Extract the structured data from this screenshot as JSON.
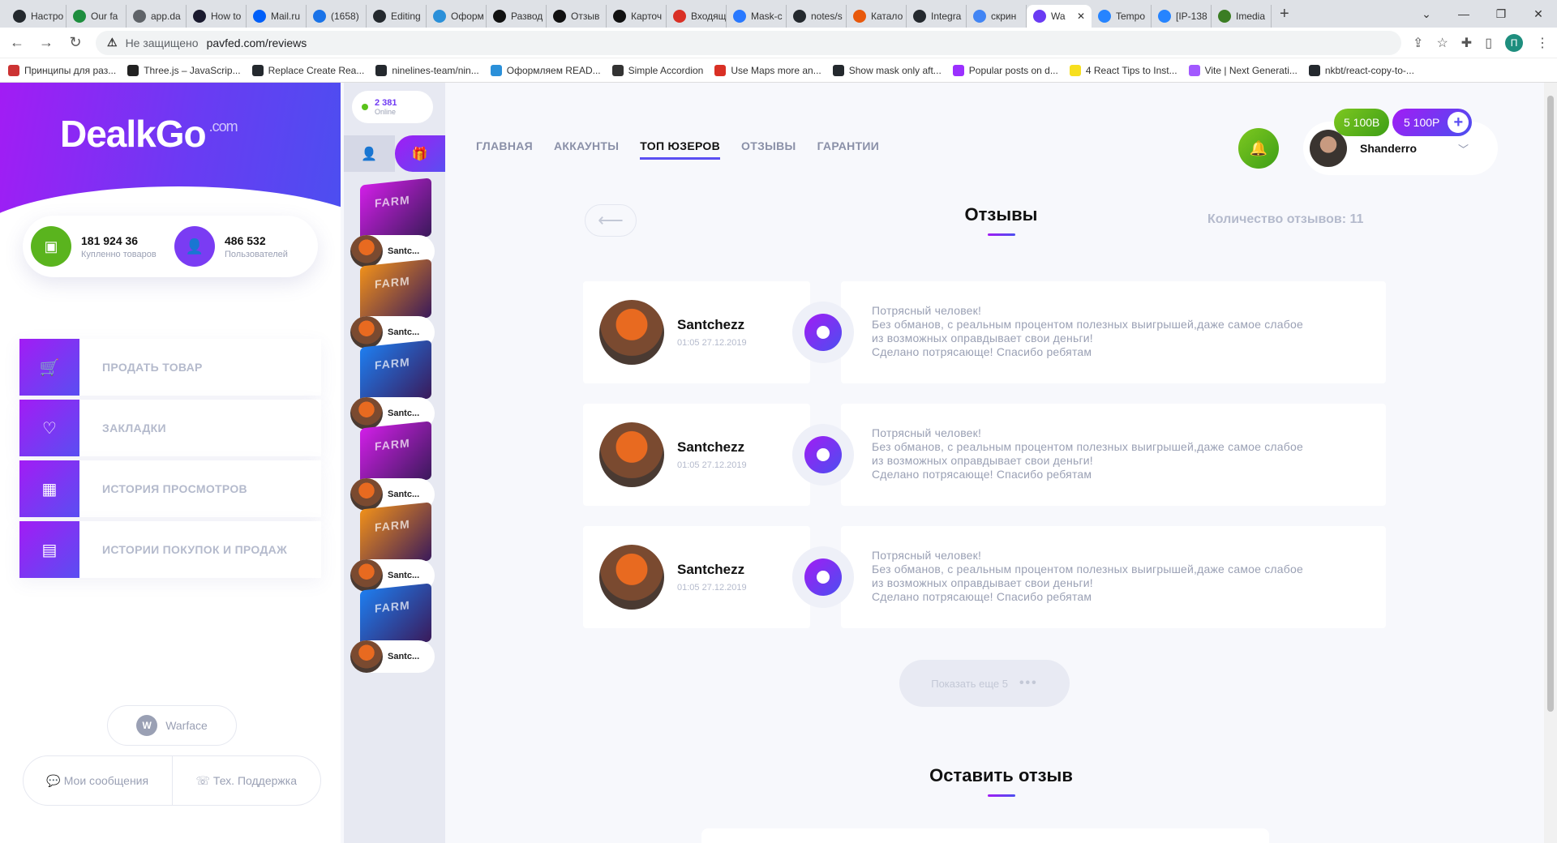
{
  "browser": {
    "tabs": [
      {
        "label": "Настро",
        "color": "#24292e"
      },
      {
        "label": "Our fa",
        "color": "#1e8e3e"
      },
      {
        "label": "app.da",
        "color": "#5f6368"
      },
      {
        "label": "How to",
        "color": "#1a1a2e"
      },
      {
        "label": "Mail.ru",
        "color": "#005ff9"
      },
      {
        "label": "(1658)",
        "color": "#1a73e8"
      },
      {
        "label": "Editing",
        "color": "#24292e"
      },
      {
        "label": "Оформ",
        "color": "#2b90d9"
      },
      {
        "label": "Развод",
        "color": "#111111"
      },
      {
        "label": "Отзыв",
        "color": "#111111"
      },
      {
        "label": "Карточ",
        "color": "#111111"
      },
      {
        "label": "Входящ",
        "color": "#d93025"
      },
      {
        "label": "Mask-c",
        "color": "#2979ff"
      },
      {
        "label": "notes/s",
        "color": "#24292e"
      },
      {
        "label": "Катало",
        "color": "#e8590c"
      },
      {
        "label": "Integra",
        "color": "#24292e"
      },
      {
        "label": "скрин",
        "color": "#4285f4"
      },
      {
        "label": "Wa",
        "color": "#6a3bf3",
        "active": true
      },
      {
        "label": "Tempo",
        "color": "#2684ff"
      },
      {
        "label": "[IP-138",
        "color": "#2684ff"
      },
      {
        "label": "Imedia",
        "color": "#3b7d23"
      }
    ],
    "new_tab": "+",
    "window_controls": [
      "⌄",
      "—",
      "❐",
      "✕"
    ],
    "security_label": "Не защищено",
    "url": "pavfed.com/reviews",
    "profile_letter": "П",
    "bookmarks": [
      {
        "label": "Принципы для раз...",
        "color": "#cc3333"
      },
      {
        "label": "Three.js – JavaScrip...",
        "color": "#222222"
      },
      {
        "label": "Replace Create Rea...",
        "color": "#24292e"
      },
      {
        "label": "ninelines-team/nin...",
        "color": "#24292e"
      },
      {
        "label": "Оформляем READ...",
        "color": "#2b90d9"
      },
      {
        "label": "Simple Accordion",
        "color": "#333333"
      },
      {
        "label": "Use Maps more an...",
        "color": "#d93025"
      },
      {
        "label": "Show mask only aft...",
        "color": "#24292e"
      },
      {
        "label": "Popular posts on d...",
        "color": "#9b30ff"
      },
      {
        "label": "4 React Tips to Inst...",
        "color": "#f7df1e"
      },
      {
        "label": "Vite | Next Generati...",
        "color": "#a259ff"
      },
      {
        "label": "nkbt/react-copy-to-...",
        "color": "#24292e"
      }
    ]
  },
  "sidebar": {
    "logo_text": "DealkGo",
    "logo_suffix": ".com",
    "stats": [
      {
        "value": "181 924 36",
        "label": "Купленно товаров",
        "color": "#5ab41e"
      },
      {
        "value": "486 532",
        "label": "Пользователей",
        "color": "#7a3cf3"
      }
    ],
    "menu": [
      {
        "label": "ПРОДАТЬ ТОВАР",
        "icon": "cart-icon",
        "glyph": "🛒"
      },
      {
        "label": "ЗАКЛАДКИ",
        "icon": "heart-icon",
        "glyph": "♡"
      },
      {
        "label": "ИСТОРИЯ ПРОСМОТРОВ",
        "icon": "grid-icon",
        "glyph": "▦"
      },
      {
        "label": "ИСТОРИИ ПОКУПОК И ПРОДАЖ",
        "icon": "receipt-icon",
        "glyph": "▤"
      }
    ],
    "game_label": "Warface",
    "messages_label": "Мои сообщения",
    "support_label": "Тех. Поддержка"
  },
  "feed": {
    "online_count": "2 381",
    "online_label": "Online",
    "box_label": "FARM",
    "items": [
      {
        "name": "Santc...",
        "color": "#d21ee8"
      },
      {
        "name": "Santc...",
        "color": "#f0901a"
      },
      {
        "name": "Santc...",
        "color": "#1e7ef0"
      },
      {
        "name": "Santc...",
        "color": "#d21ee8"
      },
      {
        "name": "Santc...",
        "color": "#f0901a"
      },
      {
        "name": "Santc...",
        "color": "#1e7ef0"
      }
    ]
  },
  "header": {
    "nav": [
      {
        "label": "ГЛАВНАЯ"
      },
      {
        "label": "АККАУНТЫ"
      },
      {
        "label": "ТОП ЮЗЕРОВ",
        "active": true
      },
      {
        "label": "ОТЗЫВЫ"
      },
      {
        "label": "ГАРАНТИИ"
      }
    ],
    "balance_primary": "5 100В",
    "balance_secondary": "5 100Р",
    "username": "Shanderro"
  },
  "reviews": {
    "title": "Отзывы",
    "count_text": "Количество отзывов: 11",
    "items": [
      {
        "author": "Santchezz",
        "date": "01:05 27.12.2019",
        "lines": [
          "Потрясный человек!",
          "Без обманов, с реальным процентом полезных выигрышей,даже самое слабое",
          "из возможных оправдывает свои деньги!",
          "Сделано потрясающе! Спасибо ребятам"
        ]
      },
      {
        "author": "Santchezz",
        "date": "01:05 27.12.2019",
        "lines": [
          "Потрясный человек!",
          "Без обманов, с реальным процентом полезных выигрышей,даже самое слабое",
          "из возможных оправдывает свои деньги!",
          "Сделано потрясающе! Спасибо ребятам"
        ]
      },
      {
        "author": "Santchezz",
        "date": "01:05 27.12.2019",
        "lines": [
          "Потрясный человек!",
          "Без обманов, с реальным процентом полезных выигрышей,даже самое слабое",
          "из возможных оправдывает свои деньги!",
          "Сделано потрясающе! Спасибо ребятам"
        ]
      }
    ],
    "show_more": "Показать еще 5",
    "leave_title": "Оставить отзыв"
  }
}
